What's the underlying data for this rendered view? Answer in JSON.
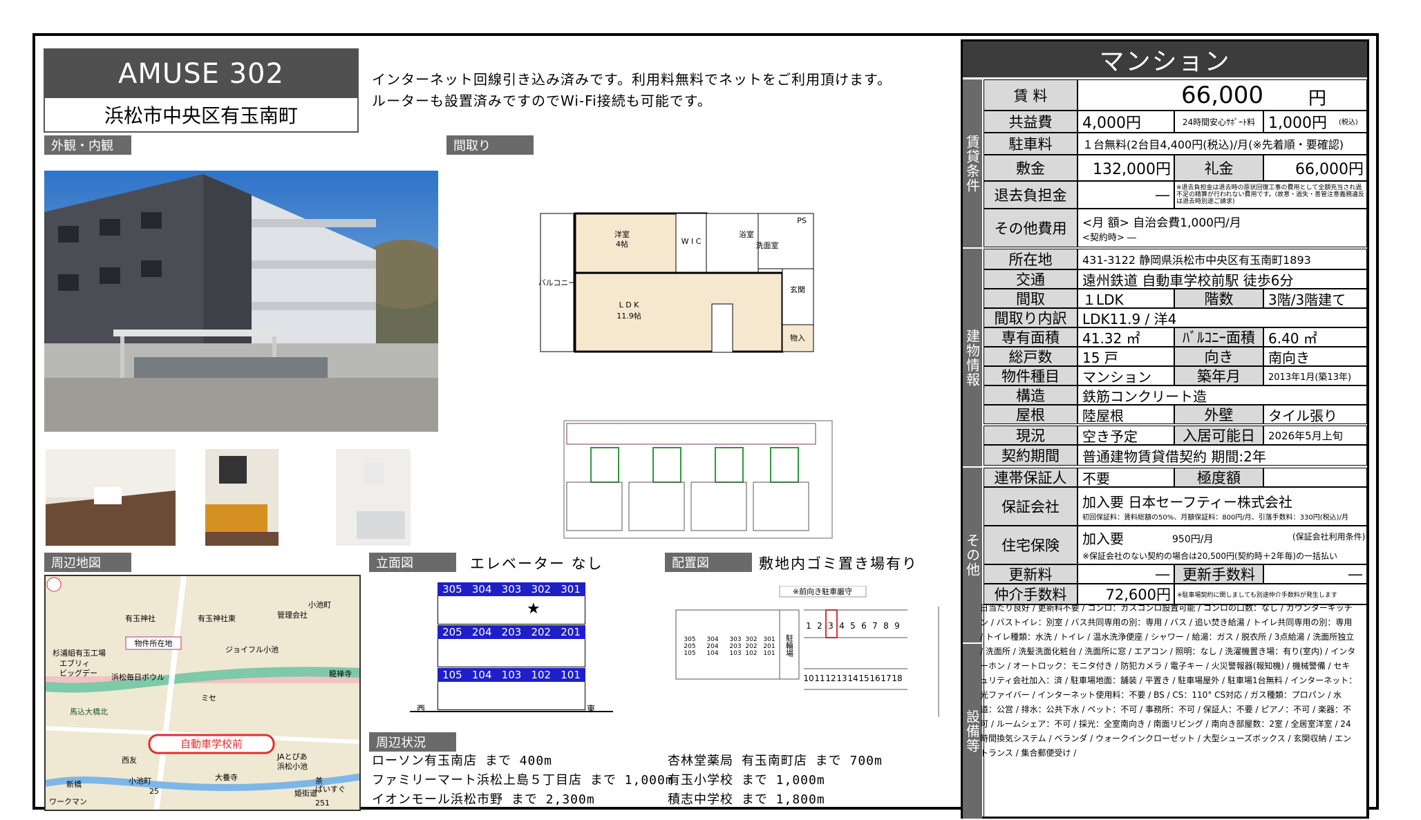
{
  "title": {
    "name": "AMUSE 302",
    "address": "浜松市中央区有玉南町"
  },
  "intro": [
    "インターネット回線引き込み済みです。利用料無料でネットをご利用頂けます。",
    "ルーターも設置済みですのでWi-Fi接続も可能です。"
  ],
  "tags": {
    "exterior": "外観・内観",
    "floorplan": "間取り",
    "map": "周辺地図",
    "elevation": "立面図",
    "layout": "配置図",
    "surroundings": "周辺状況"
  },
  "floorplan": {
    "room_western": "洋室",
    "room_western_size": "4帖",
    "wic": "W I C",
    "bath": "浴室",
    "washroom": "洗面室",
    "ps": "PS",
    "balcony": "バルコニー",
    "ldk": "L D K",
    "ldk_size": "11.9帖",
    "entrance": "玄関",
    "storage": "物入"
  },
  "elevation": {
    "note": "エレベーター なし",
    "west": "西",
    "east": "東",
    "floors": [
      [
        "305",
        "304",
        "303",
        "302",
        "301"
      ],
      [
        "205",
        "204",
        "203",
        "202",
        "201"
      ],
      [
        "105",
        "104",
        "103",
        "102",
        "101"
      ]
    ],
    "current_marker": "★"
  },
  "layout_note": "敷地内ゴミ置き場有り",
  "site": {
    "parking_note": "※前向き駐車厳守",
    "bike": "駐輪場",
    "top_slots": [
      "1",
      "2",
      "3",
      "4",
      "5",
      "6",
      "7",
      "8",
      "9"
    ],
    "bottom_slots": [
      "10",
      "11",
      "12",
      "13",
      "14",
      "15",
      "16",
      "17",
      "18"
    ],
    "units": [
      [
        "305",
        "205",
        "105"
      ],
      [
        "304",
        "204",
        "104"
      ],
      [
        "303",
        "203",
        "103"
      ],
      [
        "302",
        "202",
        "102"
      ],
      [
        "301",
        "201",
        "101"
      ]
    ]
  },
  "map": {
    "labels": [
      "有玉神社",
      "有玉神社東",
      "管理会社",
      "物件所在地",
      "ジョイフル小池",
      "杉浦組有玉工場",
      "エブリィ",
      "ビッグデー",
      "浜松毎日ボウル",
      "ミセ",
      "小池町",
      "龍禅寺",
      "馬込大橋北",
      "自動車学校前",
      "西友",
      "JAとぴあ",
      "浜松小池",
      "大養寺",
      "小池町",
      "新橋",
      "姫街道",
      "ワークマン",
      "茶",
      "ぱいすぐ",
      "25",
      "251"
    ]
  },
  "nearby_left": [
    "ローソン有玉南店 まで 400m",
    "ファミリーマート浜松上島５丁目店 まで 1,000m",
    "イオンモール浜松市野 まで 2,300m"
  ],
  "nearby_right": [
    "杏林堂薬局 有玉南町店 まで 700m",
    "有玉小学校 まで 1,000m",
    "積志中学校 まで 1,800m"
  ],
  "panel": {
    "heading": "マンション",
    "sections": {
      "rent": "賃貸条件",
      "building": "建物情報",
      "other": "その他",
      "facility": "設備等"
    },
    "rent_label": "賃 料",
    "rent_value": "66,000",
    "rent_unit": "円",
    "common_label": "共益費",
    "common_value": "4,000円",
    "support_label": "24時間安心ｻﾎﾟｰﾄ料",
    "support_value": "1,000円",
    "support_tax": "(税込)",
    "parking_label": "駐車料",
    "parking_value": "１台無料(2台目4,400円(税込)/月(※先着順・要確認)",
    "deposit_label": "敷金",
    "deposit_value": "132,000円",
    "key_label": "礼金",
    "key_value": "66,000円",
    "exit_label": "退去負担金",
    "exit_value": "―",
    "exit_note": "※退去負担金は退去時の原状回復工事の費用として全額充当され過不足の精算が行われない費用です。(故意・過失・善管注意義務違反は退去時別途ご請求)",
    "other_label": "その他費用",
    "other_value": "<月 額> 自治会費1,000円/月",
    "other_value2": "<契約時> ―",
    "address_label": "所在地",
    "address_value": "431-3122 静岡県浜松市中央区有玉南町1893",
    "traffic_label": "交通",
    "traffic_value": "遠州鉄道 自動車学校前駅 徒歩6分",
    "layout_label": "間取",
    "layout_value": "１LDK",
    "floor_label": "階数",
    "floor_value": "3階/3階建て",
    "layout_detail_label": "間取り内訳",
    "layout_detail_value": "LDK11.9 / 洋4",
    "area_label": "専有面積",
    "area_value": "41.32 ㎡",
    "balcony_label": "ﾊﾞﾙｺﾆｰ面積",
    "balcony_value": "6.40 ㎡",
    "units_label": "総戸数",
    "units_value": "15 戸",
    "direction_label": "向き",
    "direction_value": "南向き",
    "type_label": "物件種目",
    "type_value": "マンション",
    "built_label": "築年月",
    "built_value": "2013年1月(築13年)",
    "structure_label": "構造",
    "structure_value": "鉄筋コンクリート造",
    "roof_label": "屋根",
    "roof_value": "陸屋根",
    "wall_label": "外壁",
    "wall_value": "タイル張り",
    "status_label": "現況",
    "status_value": "空き予定",
    "move_label": "入居可能日",
    "move_value": "2026年5月上旬",
    "contract_label": "契約期間",
    "contract_value": "普通建物賃貸借契約 期間:2年",
    "guarantor_label": "連帯保証人",
    "guarantor_value": "不要",
    "limit_label": "極度額",
    "limit_value": "",
    "guarantee_label": "保証会社",
    "guarantee_value": "加入要 日本セーフティー株式会社",
    "guarantee_note": "初回保証料：賃料総額の50%、月額保証料：800円/月、引落手数料：330円(税込)/月",
    "insurance_label": "住宅保険",
    "insurance_value": "加入要",
    "insurance_price": "950円/月",
    "insurance_cond": "(保証会社利用条件)",
    "insurance_note": "※保証会社のない契約の場合は20,500円(契約時＋2年毎)の一括払い",
    "renew_label": "更新料",
    "renew_value": "―",
    "renew_fee_label": "更新手数料",
    "renew_fee_value": "―",
    "broker_label": "仲介手数料",
    "broker_value": "72,600円",
    "broker_note": "※駐車場契約に関しましても別途仲介手数料が発生します",
    "features": "日当たり良好 / 更新料不要 / コンロ：ガスコンロ設置可能 / コンロの口数：なし / カウンターキッチン / バストイレ：別室 / バス共同専用の別：専用 / バス / 追い焚き給湯 / トイレ共同専用の別：専用 / トイレ種類：水洗 / トイレ / 温水洗浄便座 / シャワー / 給湯：ガス / 脱衣所 / 3点給湯 / 洗面所独立 / 洗面所 / 洗髪洗面化粧台 / 洗面所に窓 / エアコン / 照明：なし / 洗濯機置き場：有り(室内) / インターホン / オートロック：モニタ付き / 防犯カメラ / 電子キー / 火災警報器(報知機) / 機械警備 / セキュリティ会社加入：済 / 駐車場地面：舗装 / 平置き / 駐車場屋外 / 駐車場1台無料 / インターネット：光ファイバー / インターネット使用料：不要 / BS / CS：110° CS対応 / ガス種類：プロパン / 水道：公営 / 排水：公共下水 / ペット：不可 / 事務所：不可 / 保証人：不要 / ピアノ：不可 / 楽器：不可 / ルームシェア：不可 / 採光：全室南向き / 南面リビング / 南向き部屋数：2室 / 全居室洋室 / 24時間換気システム / ベランダ / ウォークインクローゼット / 大型シューズボックス / 玄関収納 / エントランス / 集合郵便受け /"
  }
}
